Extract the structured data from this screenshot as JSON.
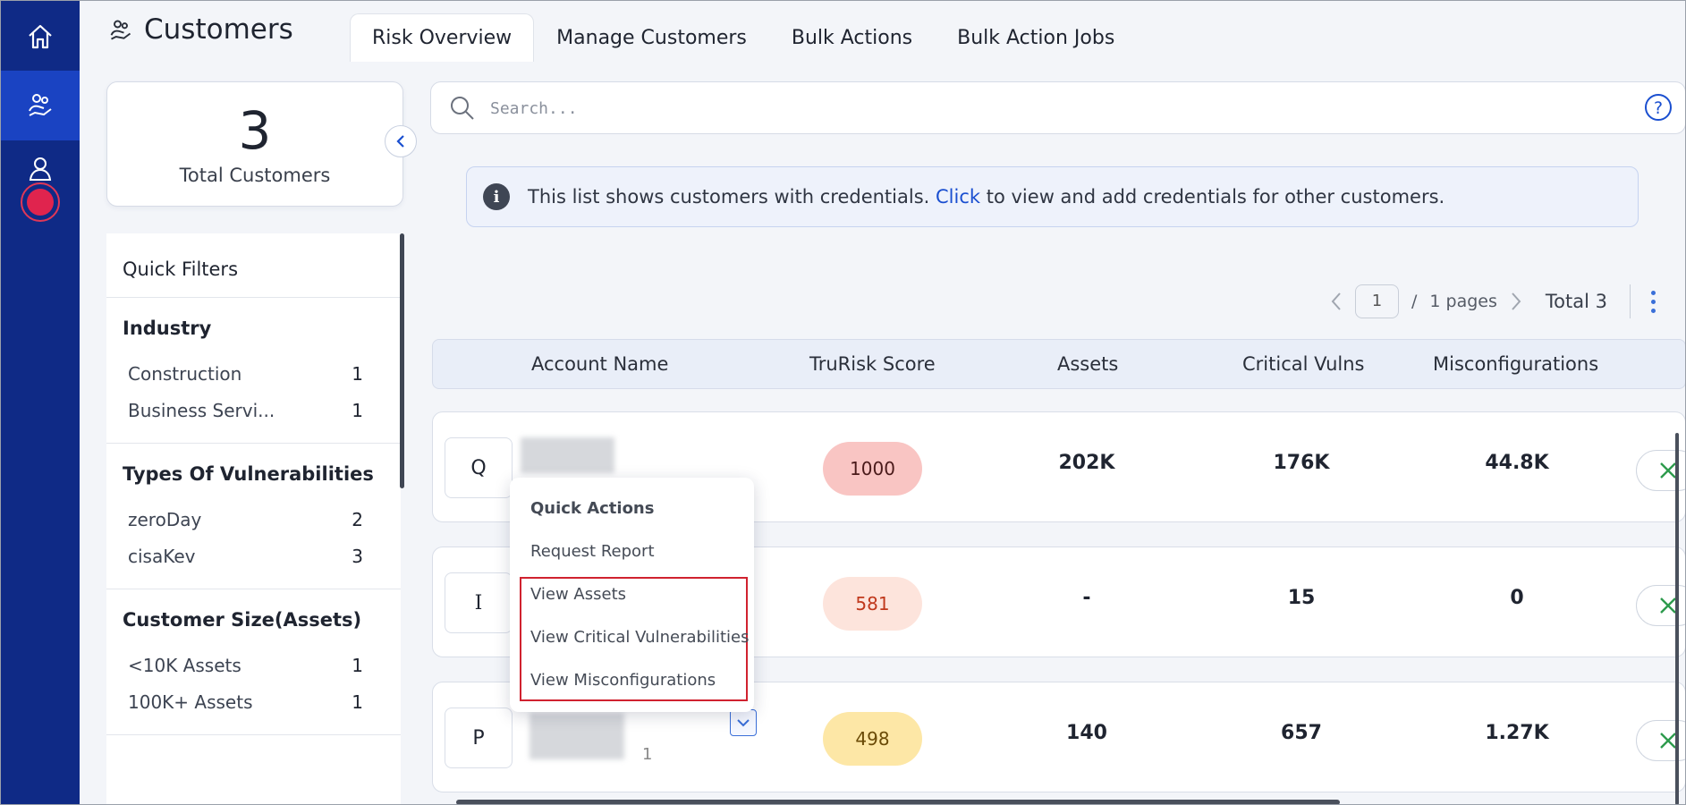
{
  "header": {
    "title": "Customers",
    "tabs": [
      {
        "label": "Risk Overview",
        "active": true
      },
      {
        "label": "Manage Customers"
      },
      {
        "label": "Bulk Actions"
      },
      {
        "label": "Bulk Action Jobs"
      }
    ]
  },
  "summary": {
    "total": "3",
    "label": "Total Customers"
  },
  "filters": {
    "title": "Quick Filters",
    "groups": [
      {
        "title": "Industry",
        "items": [
          {
            "label": "Construction",
            "count": "1"
          },
          {
            "label": "Business Servi...",
            "count": "1"
          }
        ]
      },
      {
        "title": "Types Of Vulnerabilities",
        "items": [
          {
            "label": "zeroDay",
            "count": "2"
          },
          {
            "label": "cisaKev",
            "count": "3"
          }
        ]
      },
      {
        "title": "Customer Size(Assets)",
        "items": [
          {
            "label": "<10K Assets",
            "count": "1"
          },
          {
            "label": "100K+ Assets",
            "count": "1"
          }
        ]
      }
    ]
  },
  "search": {
    "placeholder": "Search..."
  },
  "banner": {
    "text_before": "This list shows customers with credentials.",
    "link": "Click",
    "text_after": "to view and add credentials for other customers."
  },
  "pagination": {
    "page": "1",
    "separator": "/",
    "pages": "1 pages",
    "total": "Total 3"
  },
  "table": {
    "columns": [
      "Account Name",
      "TruRisk Score",
      "Assets",
      "Critical Vulns",
      "Misconfigurations"
    ],
    "rows": [
      {
        "initial": "Q",
        "score": "1000",
        "assets": "202K",
        "critical": "176K",
        "misconfig": "44.8K"
      },
      {
        "initial": "I",
        "score": "581",
        "assets": "-",
        "critical": "15",
        "misconfig": "0"
      },
      {
        "initial": "P",
        "score": "498",
        "assets": "140",
        "critical": "657",
        "misconfig": "1.27K",
        "name_suffix": "1"
      }
    ]
  },
  "menu": {
    "title": "Quick Actions",
    "items": [
      "Request Report",
      "View Assets",
      "View Critical Vulnerabilities",
      "View Misconfigurations"
    ]
  },
  "colors": {
    "rail": "#0f2a86",
    "rail_active": "#1a43c2",
    "score_critical": "#f9c5c3",
    "score_high": "#fde4dc",
    "score_medium": "#fde7a6",
    "highlight_box": "#d0222f"
  }
}
